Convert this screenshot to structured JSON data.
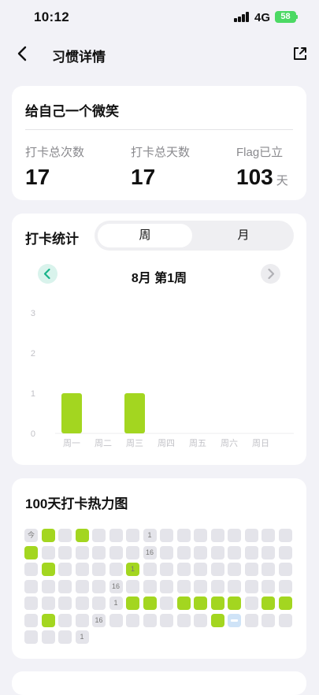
{
  "status": {
    "time": "10:12",
    "network": "4G",
    "battery": "58"
  },
  "nav": {
    "title": "习惯详情"
  },
  "habit": {
    "name": "给自己一个微笑",
    "stats": [
      {
        "label": "打卡总次数",
        "value": "17",
        "unit": ""
      },
      {
        "label": "打卡总天数",
        "value": "17",
        "unit": ""
      },
      {
        "label": "Flag已立",
        "value": "103",
        "unit": "天"
      }
    ]
  },
  "checkin": {
    "title": "打卡统计",
    "tabs": [
      "周",
      "月"
    ],
    "active_tab": "周",
    "period": "8月 第1周"
  },
  "chart_data": {
    "type": "bar",
    "categories": [
      "周一",
      "周二",
      "周三",
      "周四",
      "周五",
      "周六",
      "周日"
    ],
    "values": [
      1,
      0,
      1,
      0,
      0,
      0,
      0
    ],
    "yticks": [
      "0",
      "1",
      "2",
      "3"
    ],
    "ylim": [
      0,
      3
    ],
    "grid": false,
    "bar_color": "#a3d620"
  },
  "heatmap": {
    "title": "100天打卡热力图",
    "columns": 16,
    "on_color": "#a3d620",
    "off_color": "#e4e4ea",
    "labels": {
      "0": "今",
      "7": "1",
      "23": "16",
      "38": "1",
      "53": "16",
      "69": "1",
      "84": "16",
      "99": "1"
    },
    "on_cells": [
      1,
      3,
      16,
      33,
      38,
      70,
      71,
      73,
      74,
      75,
      76,
      78,
      79,
      81,
      91
    ],
    "today_cell": 92,
    "total": 100
  }
}
